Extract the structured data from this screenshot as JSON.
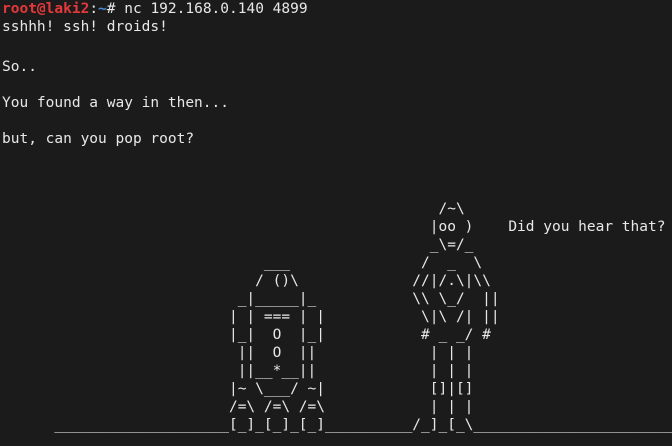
{
  "prompt": {
    "user_host": "root@laki2",
    "colon": ":",
    "path": "~",
    "symbol": "# ",
    "command": "nc 192.168.0.140 4899"
  },
  "output": {
    "line_1": "sshhh! ssh! droids!",
    "line_2": "So..",
    "line_3": "You found a way in then...",
    "line_4": "but, can you pop root?"
  },
  "ascii_art": "                                                  /~\\\n                                                 |oo )    Did you hear that?\n                                                 _\\=/_\n                              ___               /  _  \\\n                             / ()\\             //|/.\\|\\\\\n                           _|_____|_           \\\\ \\_/  ||\n                          | | === | |           \\|\\ /| ||\n                          |_|  O  |_|           # _ _/ #\n                           ||  O  ||             | | |\n                           ||__*__||             | | |\n                          |~ \\___/ ~|            []|[]\n                          /=\\ /=\\ /=\\            | | |\n      ____________________[_]_[_]_[_]__________/_]_[_\\_______________________"
}
